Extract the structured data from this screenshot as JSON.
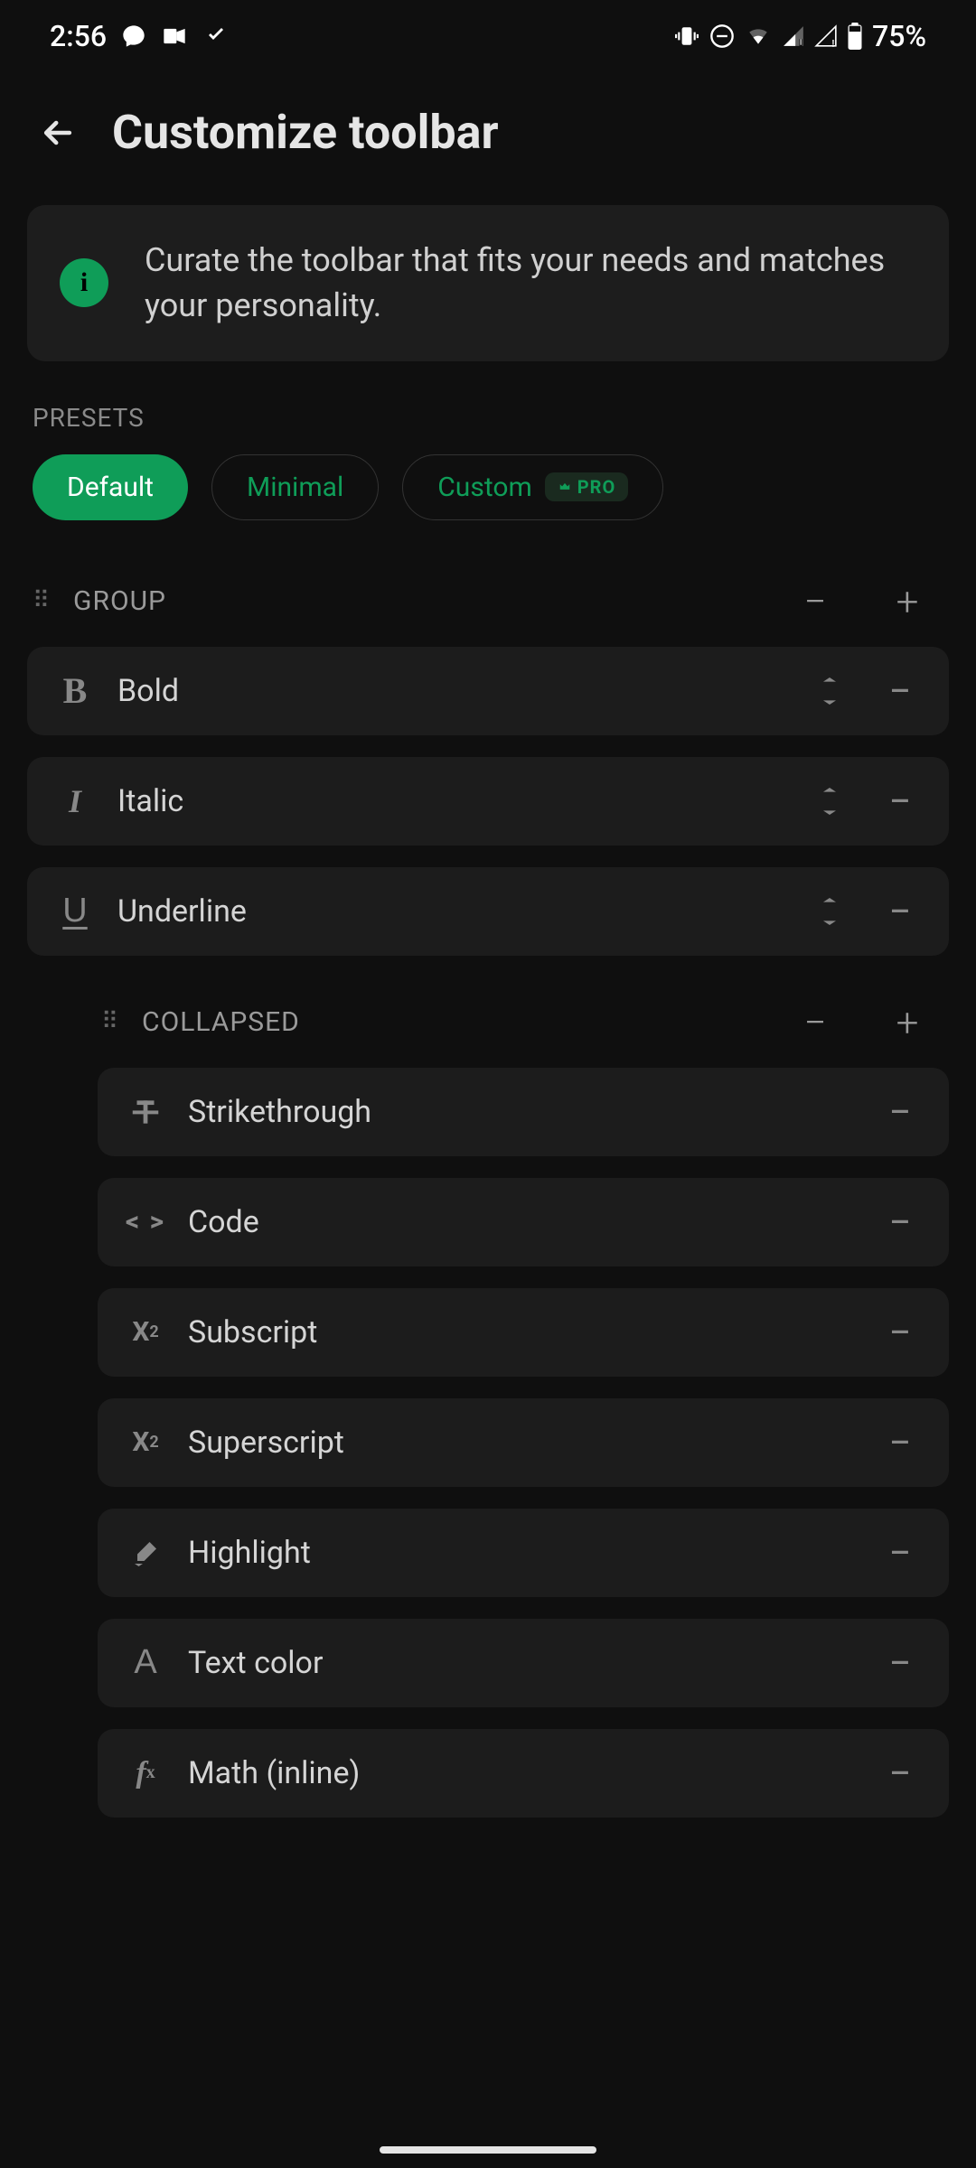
{
  "status": {
    "time": "2:56",
    "battery": "75%"
  },
  "header": {
    "title": "Customize toolbar"
  },
  "info": {
    "text": "Curate the toolbar that fits your needs and matches your personality."
  },
  "presets": {
    "label": "PRESETS",
    "items": [
      {
        "label": "Default",
        "active": true
      },
      {
        "label": "Minimal",
        "active": false
      },
      {
        "label": "Custom",
        "active": false,
        "pro": true,
        "pro_label": "PRO"
      }
    ]
  },
  "groups": [
    {
      "title": "GROUP",
      "indented": false,
      "items": [
        {
          "icon": "bold",
          "label": "Bold",
          "sortable": true
        },
        {
          "icon": "italic",
          "label": "Italic",
          "sortable": true
        },
        {
          "icon": "underline",
          "label": "Underline",
          "sortable": true
        }
      ]
    },
    {
      "title": "COLLAPSED",
      "indented": true,
      "items": [
        {
          "icon": "strikethrough",
          "label": "Strikethrough",
          "sortable": false
        },
        {
          "icon": "code",
          "label": "Code",
          "sortable": false
        },
        {
          "icon": "subscript",
          "label": "Subscript",
          "sortable": false
        },
        {
          "icon": "superscript",
          "label": "Superscript",
          "sortable": false
        },
        {
          "icon": "highlight",
          "label": "Highlight",
          "sortable": false
        },
        {
          "icon": "textcolor",
          "label": "Text color",
          "sortable": false
        },
        {
          "icon": "math",
          "label": "Math (inline)",
          "sortable": false
        }
      ]
    }
  ]
}
